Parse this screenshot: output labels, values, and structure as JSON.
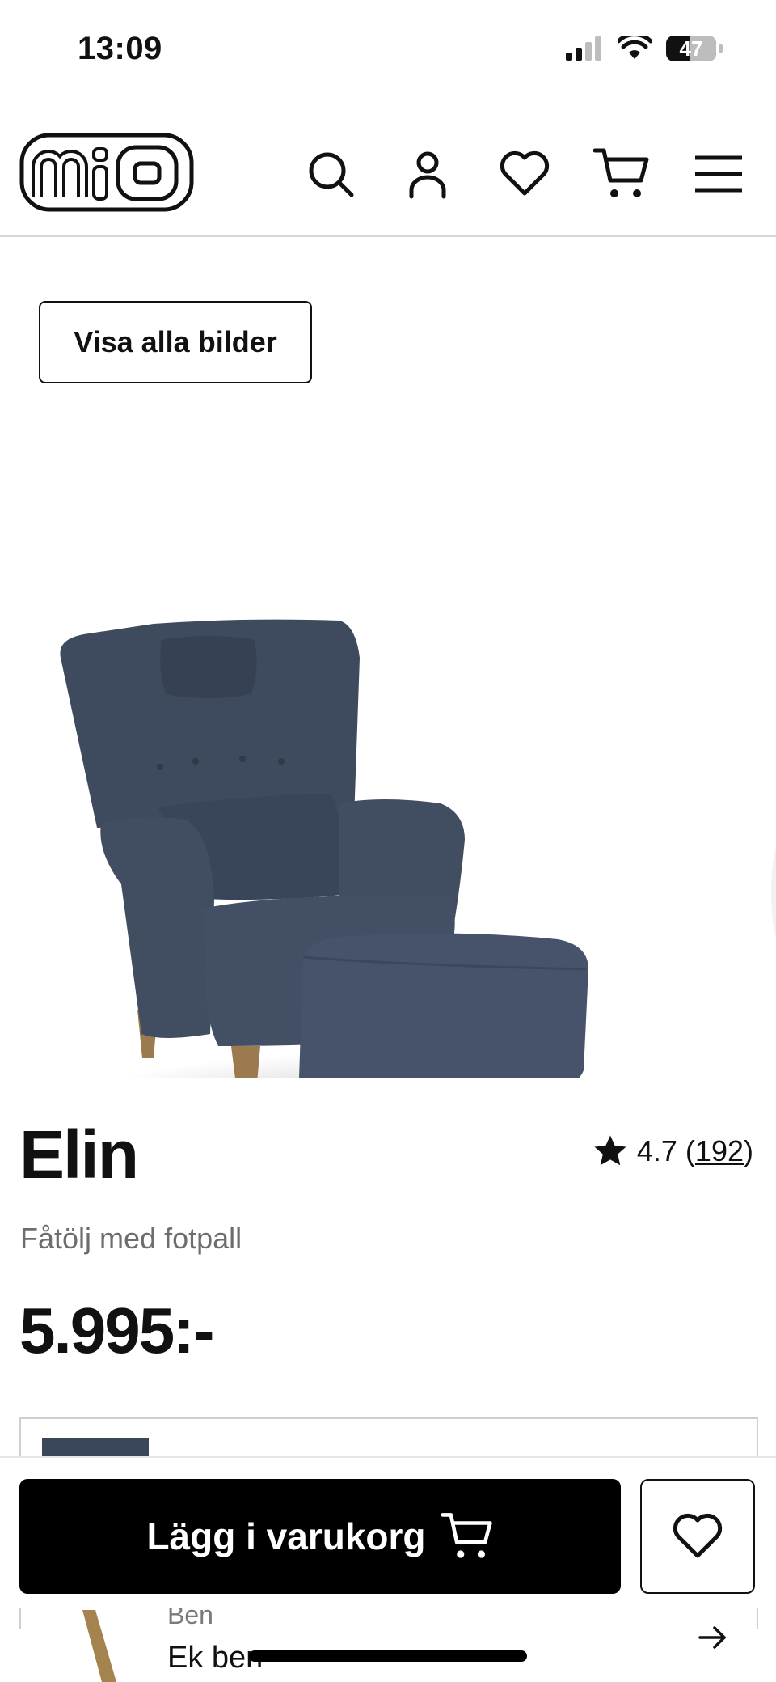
{
  "status_bar": {
    "time": "13:09",
    "battery": "47",
    "battery_level": 0.47,
    "icons": [
      "cellular-signal-icon",
      "wifi-icon",
      "battery-icon"
    ]
  },
  "header": {
    "logo": "mio",
    "icons": [
      "search-icon",
      "account-icon",
      "heart-icon",
      "cart-icon",
      "menu-icon"
    ]
  },
  "gallery": {
    "view_all_label": "Visa alla bilder"
  },
  "product": {
    "name": "Elin",
    "rating": "4.7",
    "review_count": "192",
    "subtitle": "Fåtölj med fotpall",
    "price": "5.995:-"
  },
  "variant": {
    "leg_label": "Ben",
    "leg_value": "Ek ben"
  },
  "actions": {
    "add_to_cart_label": "Lägg i varukorg"
  },
  "colors": {
    "fabric": "#3e4a5d",
    "wood_legs": "#9a7a4e",
    "button_bg": "#000000",
    "muted_text": "#6d6d6d"
  }
}
